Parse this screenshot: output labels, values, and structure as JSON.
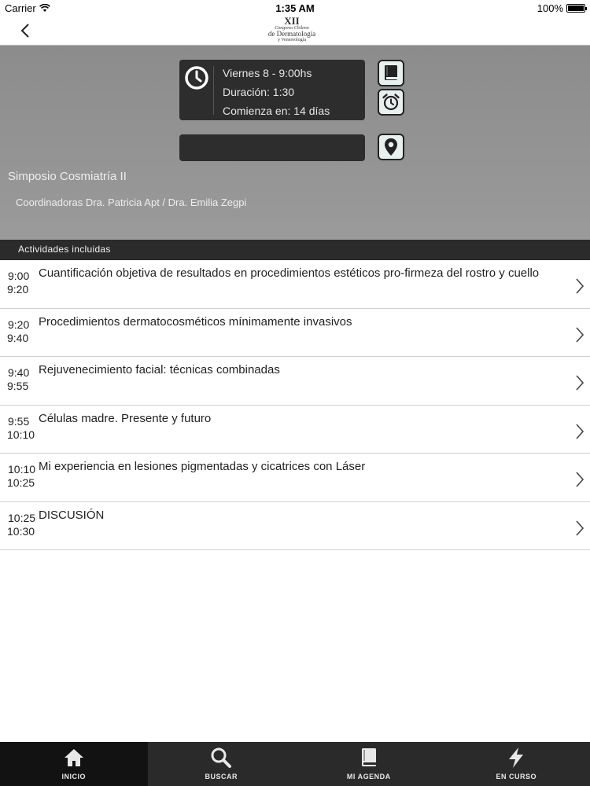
{
  "status_bar": {
    "carrier": "Carrier",
    "time": "1:35 AM",
    "battery": "100%"
  },
  "nav": {
    "logo": {
      "number": "XII",
      "line1": "Congreso Chileno",
      "line2": "de Dermatología",
      "line3": "y Venereología"
    }
  },
  "session": {
    "day_time": "Viernes 8 - 9:00hs",
    "duration": "Duración: 1:30",
    "starts_in": "Comienza en: 14 días",
    "location": "",
    "title": "Simposio Cosmiatría II",
    "coordinators": "Coordinadoras Dra. Patricia Apt / Dra. Emilia Zegpi"
  },
  "section": {
    "label": "Actividades incluidas"
  },
  "activities": [
    {
      "start": "9:00",
      "end": "9:20",
      "title": "Cuantificación objetiva de resultados en procedimientos estéticos pro-firmeza del rostro y cuello"
    },
    {
      "start": "9:20",
      "end": "9:40",
      "title": "Procedimientos dermatocosméticos mínimamente invasivos"
    },
    {
      "start": "9:40",
      "end": "9:55",
      "title": "Rejuvenecimiento facial: técnicas combinadas"
    },
    {
      "start": "9:55",
      "end": "10:10",
      "title": "Células madre. Presente y futuro"
    },
    {
      "start": "10:10",
      "end": "10:25",
      "title": "Mi experiencia en lesiones pigmentadas y cicatrices con Láser"
    },
    {
      "start": "10:25",
      "end": "10:30",
      "title": "DISCUSIÓN"
    }
  ],
  "tabs": [
    {
      "label": "INICIO",
      "icon": "home-icon",
      "active": true
    },
    {
      "label": "BUSCAR",
      "icon": "search-icon",
      "active": false
    },
    {
      "label": "MI AGENDA",
      "icon": "book-icon",
      "active": false
    },
    {
      "label": "EN CURSO",
      "icon": "lightning-icon",
      "active": false
    }
  ],
  "colors": {
    "header_bg": "#8c8c8c",
    "card_bg": "#2d2d2d",
    "section_bar": "#2b2b2b",
    "tabbar": "#2a2a2a",
    "tab_active": "#121212",
    "icon_button_bg": "#e8efef"
  }
}
